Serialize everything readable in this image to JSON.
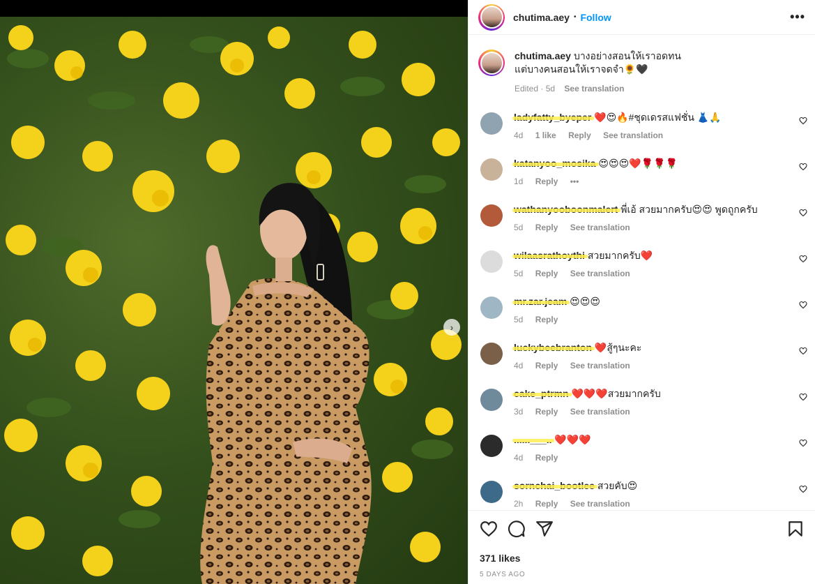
{
  "post": {
    "username": "chutima.aey",
    "follow_label": "Follow",
    "more_icon": "more-horizontal-icon",
    "caption_lines": [
      "บางอย่างสอนให้เราอดทน",
      "แต่บางคนสอนให้เราจดจำ🌻🖤"
    ],
    "caption_meta": {
      "edited": "Edited · 5d",
      "translation": "See translation"
    }
  },
  "comments": [
    {
      "user": "ladyfatty_byeper",
      "text": "❤️😍🔥#ชุดเดรสแฟชั่น 👗🙏",
      "time": "4d",
      "likes": "1 like",
      "reply": "Reply",
      "translate": "See translation",
      "avatar_color": "#8fa3b0"
    },
    {
      "user": "katanyoo_mosika",
      "text": "😍😍😍❤️🌹🌹🌹",
      "time": "1d",
      "likes": "",
      "reply": "Reply",
      "translate": "•••",
      "avatar_color": "#c9b29a"
    },
    {
      "user": "wathanyooboonmalert",
      "text": "พี่เอ้ สวยมากครับ😍😍 พูดถูกครับ",
      "time": "5d",
      "likes": "",
      "reply": "Reply",
      "translate": "See translation",
      "avatar_color": "#b35a3a"
    },
    {
      "user": "wilaasrathoythi",
      "text": "สวยมากครับ❤️",
      "time": "5d",
      "likes": "",
      "reply": "Reply",
      "translate": "See translation",
      "avatar_color": "#dcdcdc"
    },
    {
      "user": "mr.zar.jeam",
      "text": "😍😍😍",
      "time": "5d",
      "likes": "",
      "reply": "Reply",
      "translate": "",
      "avatar_color": "#9fb7c4"
    },
    {
      "user": "luckybeebranton",
      "text": "❤️สู้ๆนะคะ",
      "time": "4d",
      "likes": "",
      "reply": "Reply",
      "translate": "See translation",
      "avatar_color": "#7a6048"
    },
    {
      "user": "cake_ptrmn",
      "text": "❤️❤️❤️สวยมากครับ",
      "time": "3d",
      "likes": "",
      "reply": "Reply",
      "translate": "See translation",
      "avatar_color": "#6f8a9a"
    },
    {
      "user": "......___..",
      "text": "❤️❤️❤️",
      "time": "4d",
      "likes": "",
      "reply": "Reply",
      "translate": "",
      "avatar_color": "#2b2b2b"
    },
    {
      "user": "sornchai_bootlee",
      "text": "สวยคับ😍",
      "time": "2h",
      "likes": "",
      "reply": "Reply",
      "translate": "See translation",
      "avatar_color": "#3e6a8a"
    }
  ],
  "footer": {
    "likes": "371 likes",
    "ago": "5 DAYS AGO",
    "icons": [
      "heart-icon",
      "comment-icon",
      "share-icon",
      "bookmark-icon"
    ]
  },
  "media": {
    "next_icon": "chevron-right-icon",
    "next_glyph": "›"
  }
}
